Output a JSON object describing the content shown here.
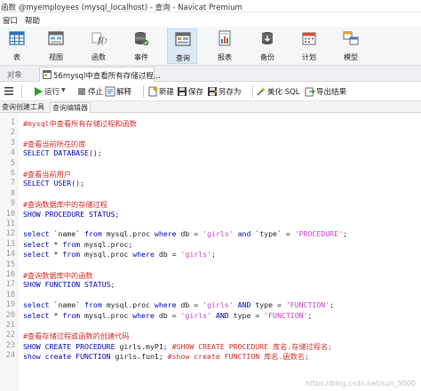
{
  "window": {
    "title": "函数 @myemployees (mysql_localhost) - 查询 - Navicat Premium"
  },
  "menu": {
    "items": [
      "窗口",
      "帮助"
    ]
  },
  "toolbar": {
    "buttons": [
      {
        "label": "表",
        "icon": "table-icon"
      },
      {
        "label": "视图",
        "icon": "view-icon"
      },
      {
        "label": "函数",
        "icon": "function-icon"
      },
      {
        "label": "事件",
        "icon": "event-icon"
      },
      {
        "label": "查询",
        "icon": "query-icon",
        "active": true
      },
      {
        "label": "报表",
        "icon": "report-icon"
      },
      {
        "label": "备份",
        "icon": "backup-icon"
      },
      {
        "label": "计划",
        "icon": "schedule-icon"
      },
      {
        "label": "模型",
        "icon": "model-icon"
      }
    ]
  },
  "tabs": {
    "objects_label": "对象",
    "query_tab_label": "56mysql中查看所有存储过程..."
  },
  "actions": {
    "run_label": "运行",
    "stop_label": "停止",
    "explain_label": "解释",
    "new_label": "新建",
    "save_label": "保存",
    "save_as_label": "另存为",
    "beautify_label": "美化 SQL",
    "export_label": "导出结果"
  },
  "subtabs": {
    "builder": "查询创建工具",
    "editor": "查询编辑器"
  },
  "editor": {
    "lines": [
      {
        "n": "1",
        "parts": [
          [
            "c",
            "#mysql中查看所有存储过程和函数"
          ]
        ]
      },
      {
        "n": "2",
        "parts": []
      },
      {
        "n": "3",
        "parts": [
          [
            "c",
            "#查看当前所在的库"
          ]
        ]
      },
      {
        "n": "4",
        "parts": [
          [
            "k",
            "SELECT DATABASE"
          ],
          [
            "p",
            "();"
          ]
        ]
      },
      {
        "n": "5",
        "parts": []
      },
      {
        "n": "6",
        "parts": [
          [
            "c",
            "#查看当前用户"
          ]
        ]
      },
      {
        "n": "7",
        "parts": [
          [
            "k",
            "SELECT USER"
          ],
          [
            "p",
            "();"
          ]
        ]
      },
      {
        "n": "8",
        "parts": []
      },
      {
        "n": "9",
        "parts": [
          [
            "c",
            "#查询数据库中的存储过程"
          ]
        ]
      },
      {
        "n": "10",
        "parts": [
          [
            "k",
            "SHOW PROCEDURE STATUS"
          ],
          [
            "p",
            ";"
          ]
        ]
      },
      {
        "n": "11",
        "parts": []
      },
      {
        "n": "12",
        "parts": [
          [
            "k",
            "select "
          ],
          [
            "p",
            "`name` "
          ],
          [
            "k",
            "from "
          ],
          [
            "p",
            "mysql.proc "
          ],
          [
            "k",
            "where "
          ],
          [
            "p",
            "db = "
          ],
          [
            "s",
            "'girls'"
          ],
          [
            "k",
            " and "
          ],
          [
            "p",
            "`type` = "
          ],
          [
            "s",
            "'PROCEDURE'"
          ],
          [
            "p",
            ";"
          ]
        ]
      },
      {
        "n": "13",
        "parts": [
          [
            "k",
            "select "
          ],
          [
            "p",
            "* "
          ],
          [
            "k",
            "from "
          ],
          [
            "p",
            "mysql.proc;"
          ]
        ]
      },
      {
        "n": "14",
        "parts": [
          [
            "k",
            "select "
          ],
          [
            "p",
            "* "
          ],
          [
            "k",
            "from "
          ],
          [
            "p",
            "mysql.proc "
          ],
          [
            "k",
            "where "
          ],
          [
            "p",
            "db = "
          ],
          [
            "s",
            "'girls'"
          ],
          [
            "p",
            ";"
          ]
        ]
      },
      {
        "n": "15",
        "parts": []
      },
      {
        "n": "16",
        "parts": [
          [
            "c",
            "#查询数据库中的函数"
          ]
        ]
      },
      {
        "n": "17",
        "parts": [
          [
            "k",
            "SHOW FUNCTION STATUS"
          ],
          [
            "p",
            ";"
          ]
        ]
      },
      {
        "n": "18",
        "parts": []
      },
      {
        "n": "19",
        "parts": [
          [
            "k",
            "select "
          ],
          [
            "p",
            "`name` "
          ],
          [
            "k",
            "from "
          ],
          [
            "p",
            "mysql.proc "
          ],
          [
            "k",
            "where "
          ],
          [
            "p",
            "db = "
          ],
          [
            "s",
            "'girls'"
          ],
          [
            "k",
            " AND "
          ],
          [
            "p",
            "type = "
          ],
          [
            "s",
            "'FUNCTION'"
          ],
          [
            "p",
            ";"
          ]
        ]
      },
      {
        "n": "20",
        "parts": [
          [
            "k",
            "select "
          ],
          [
            "p",
            "* "
          ],
          [
            "k",
            "from "
          ],
          [
            "p",
            "mysql.proc "
          ],
          [
            "k",
            "where "
          ],
          [
            "p",
            "db = "
          ],
          [
            "s",
            "'girls'"
          ],
          [
            "k",
            " AND "
          ],
          [
            "p",
            "type = "
          ],
          [
            "s",
            "'FUNCTION'"
          ],
          [
            "p",
            ";"
          ]
        ]
      },
      {
        "n": "21",
        "parts": []
      },
      {
        "n": "22",
        "parts": [
          [
            "c",
            "#查看存储过程或函数的创建代码"
          ]
        ]
      },
      {
        "n": "23",
        "parts": [
          [
            "k",
            "SHOW CREATE PROCEDURE "
          ],
          [
            "p",
            "girls.myP1; "
          ],
          [
            "c",
            "#SHOW CREATE PROCEDURE 库名.存储过程名;"
          ]
        ]
      },
      {
        "n": "24",
        "parts": [
          [
            "k",
            "show create FUNCTION "
          ],
          [
            "p",
            "girls.fun1; "
          ],
          [
            "c",
            "#show create FUNCTION 库名.函数名;"
          ]
        ]
      }
    ]
  },
  "watermark": "https://blog.csdn.net/sun_5000"
}
